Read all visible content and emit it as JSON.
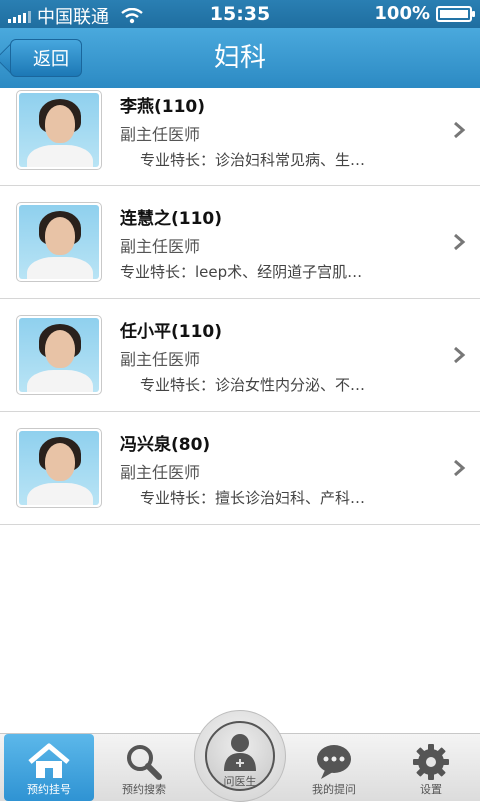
{
  "status": {
    "carrier": "中国联通",
    "time": "15:35",
    "battery": "100%"
  },
  "nav": {
    "back_label": "返回",
    "title": "妇科"
  },
  "doctors": [
    {
      "name": "李燕(110)",
      "title": "副主任医师",
      "specialty": "专业特长：诊治妇科常见病、生…"
    },
    {
      "name": "连慧之(110)",
      "title": "副主任医师",
      "specialty": "专业特长：leep术、经阴道子宫肌…"
    },
    {
      "name": "任小平(110)",
      "title": "副主任医师",
      "specialty": "专业特长：诊治女性内分泌、不…"
    },
    {
      "name": "冯兴泉(80)",
      "title": "副主任医师",
      "specialty": "专业特长：擅长诊治妇科、产科…"
    }
  ],
  "tabs": [
    {
      "label": "预约挂号",
      "icon": "home-icon",
      "active": true
    },
    {
      "label": "预约搜索",
      "icon": "search-icon",
      "active": false
    },
    {
      "label": "问医生",
      "icon": "doctor-icon",
      "active": false
    },
    {
      "label": "我的提问",
      "icon": "chat-bubble-icon",
      "active": false
    },
    {
      "label": "设置",
      "icon": "gear-icon",
      "active": false
    }
  ],
  "colors": {
    "nav_bar": "#3a9ad3",
    "active_tab": "#2f93d3"
  }
}
